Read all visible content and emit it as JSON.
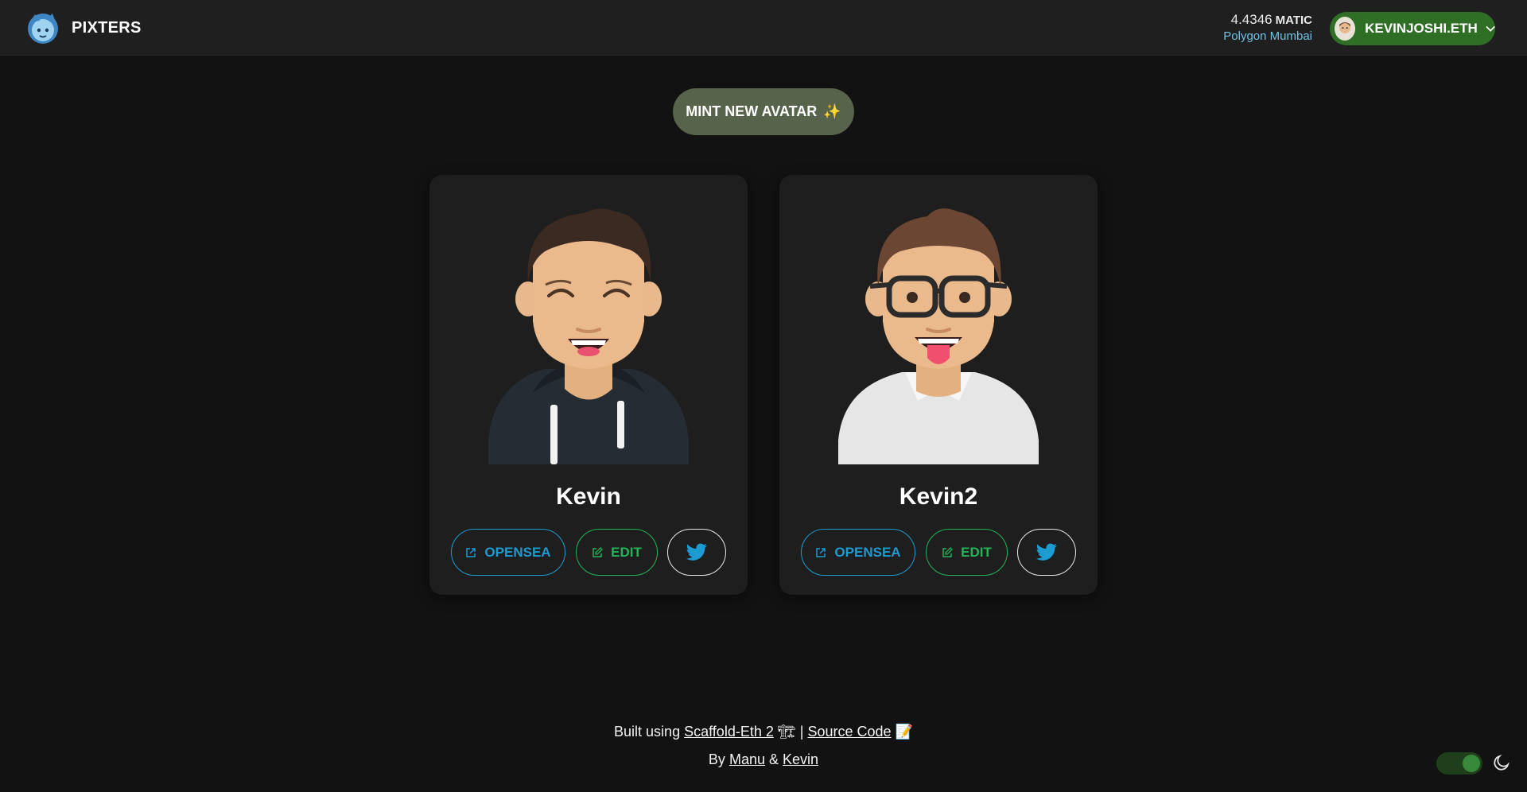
{
  "header": {
    "brand": "PIXTERS",
    "balance_amount": "4.4346",
    "balance_unit": "MATIC",
    "network": "Polygon Mumbai",
    "account_name": "KEVINJOSHI.ETH",
    "logo_icon": "pixters-logo-icon",
    "chevron_icon": "chevron-down-icon"
  },
  "mint_button": {
    "label": "MINT NEW AVATAR",
    "emoji": "✨"
  },
  "cards": [
    {
      "name": "Kevin",
      "opensea_label": "OPENSEA",
      "edit_label": "EDIT",
      "share_icon": "twitter-icon"
    },
    {
      "name": "Kevin2",
      "opensea_label": "OPENSEA",
      "edit_label": "EDIT",
      "share_icon": "twitter-icon"
    }
  ],
  "footer": {
    "built_prefix": "Built using",
    "scaffold_link": "Scaffold-Eth 2",
    "scaffold_emoji": "🏗",
    "separator": "|",
    "source_link": "Source Code",
    "source_emoji": "📝",
    "by_prefix": "By",
    "author1": "Manu",
    "ampersand": "&",
    "author2": "Kevin"
  },
  "theme": {
    "mode": "dark",
    "toggle_on": true,
    "accent": "#2f6e25"
  }
}
